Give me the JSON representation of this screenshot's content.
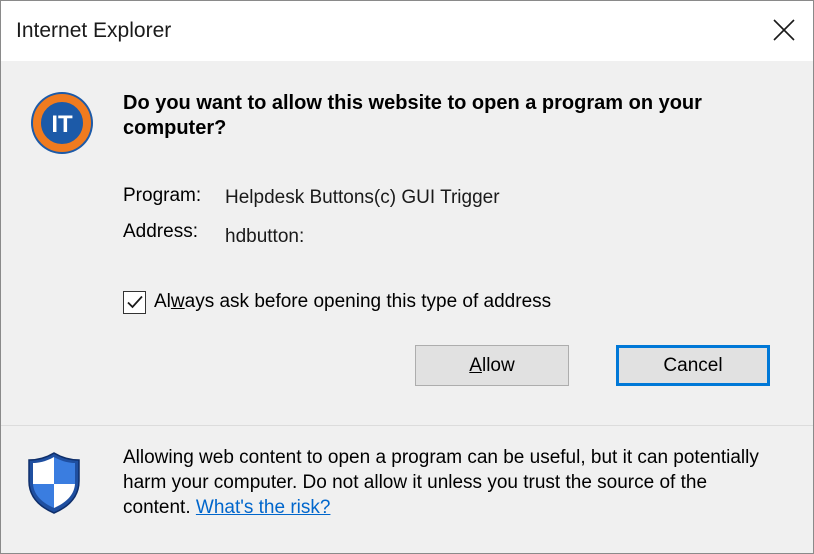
{
  "window": {
    "title": "Internet Explorer",
    "close_icon": "close-icon"
  },
  "logo": {
    "text": "IT",
    "ring_color": "#f07b1f",
    "fill_color": "#1c5aa8"
  },
  "prompt": {
    "heading": "Do you want to allow this website to open a program on your computer?",
    "program_label": "Program:",
    "program_value": "Helpdesk Buttons(c) GUI Trigger",
    "address_label": "Address:",
    "address_value": "hdbutton:"
  },
  "checkbox": {
    "checked": true,
    "label_pre": "Al",
    "label_accel": "w",
    "label_post": "ays ask before opening this type of address"
  },
  "buttons": {
    "allow_accel": "A",
    "allow_rest": "llow",
    "cancel": "Cancel"
  },
  "footer": {
    "icon": "shield-icon",
    "warning": "Allowing web content to open a program can be useful, but it can potentially harm your computer. Do not allow it unless you trust the source of the content.",
    "link": "What's the risk?"
  },
  "colors": {
    "accent": "#0078d7",
    "link": "#0066cc"
  }
}
